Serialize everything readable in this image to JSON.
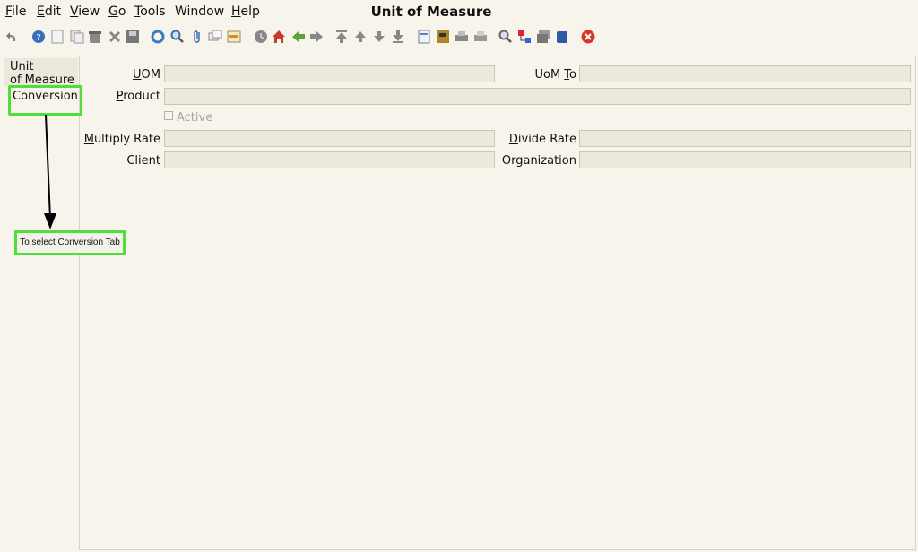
{
  "menu": {
    "file": {
      "u": "F",
      "rest": "ile"
    },
    "edit": {
      "u": "E",
      "rest": "dit"
    },
    "view": {
      "u": "V",
      "rest": "iew"
    },
    "go": {
      "u": "G",
      "rest": "o"
    },
    "tools": {
      "u": "T",
      "rest": "ools"
    },
    "window": {
      "u": "",
      "rest": "Window"
    },
    "help": {
      "u": "H",
      "rest": "elp"
    }
  },
  "window_title": "Unit of Measure",
  "toolbar_icons": [
    "undo-icon",
    "help-icon",
    "new-record-icon",
    "copy-record-icon",
    "delete-icon",
    "delete-selection-icon",
    "save-icon",
    "refresh-icon",
    "find-icon",
    "attachment-icon",
    "chat-icon",
    "grid-toggle-icon",
    "history-icon",
    "home-icon",
    "back-icon",
    "forward-icon",
    "first-record-icon",
    "previous-record-icon",
    "next-record-icon",
    "last-record-icon",
    "report-icon",
    "archive-icon",
    "print-icon",
    "print-preview-icon",
    "zoom-across-icon",
    "workflow-icon",
    "product-info-icon",
    "lock-icon",
    "exit-icon"
  ],
  "tabs": {
    "uom_line1": "Unit",
    "uom_line2": "of Measure",
    "conversion": "Conversion"
  },
  "form": {
    "uom_label": {
      "u": "U",
      "rest": "OM"
    },
    "uom_to_label": {
      "pre": "UoM ",
      "u": "T",
      "rest": "o"
    },
    "product_label": {
      "u": "P",
      "rest": "roduct"
    },
    "active_label": "Active",
    "multiply_rate_label": {
      "u": "M",
      "rest": "ultiply Rate"
    },
    "divide_rate_label": {
      "u": "D",
      "rest": "ivide Rate"
    },
    "client_label": "Client",
    "organization_label": "Organization",
    "uom_value": "",
    "uom_to_value": "",
    "product_value": "",
    "multiply_rate_value": "",
    "divide_rate_value": "",
    "client_value": "",
    "organization_value": ""
  },
  "annotation": {
    "callout_text": "To select Conversion Tab"
  },
  "colors": {
    "highlight": "#4fde3a",
    "background": "#f7f4ec",
    "field": "#ece9dc"
  }
}
